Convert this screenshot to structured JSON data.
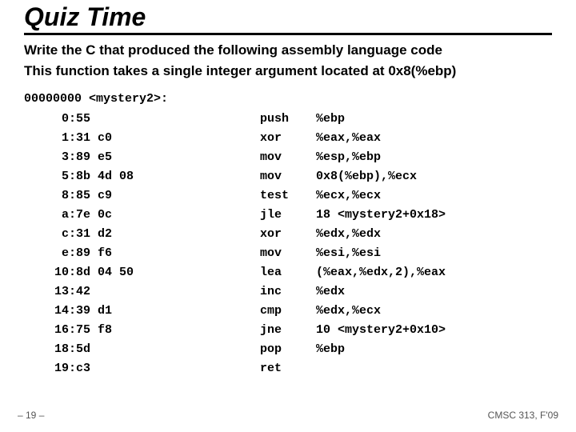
{
  "title": "Quiz Time",
  "subtitle_line1": "Write the C that produced the following assembly language code",
  "subtitle_line2": "This function takes a single integer argument located at 0x8(%ebp)",
  "disasm_header": "00000000 <mystery2>:",
  "rows": [
    {
      "addr": "0:",
      "hex": "55",
      "mnem": "push",
      "oper": "%ebp"
    },
    {
      "addr": "1:",
      "hex": "31 c0",
      "mnem": "xor",
      "oper": "%eax,%eax"
    },
    {
      "addr": "3:",
      "hex": "89 e5",
      "mnem": "mov",
      "oper": "%esp,%ebp"
    },
    {
      "addr": "5:",
      "hex": "8b 4d 08",
      "mnem": "mov",
      "oper": "0x8(%ebp),%ecx"
    },
    {
      "addr": "8:",
      "hex": "85 c9",
      "mnem": "test",
      "oper": "%ecx,%ecx"
    },
    {
      "addr": "a:",
      "hex": "7e 0c",
      "mnem": "jle",
      "oper": "18 <mystery2+0x18>"
    },
    {
      "addr": "c:",
      "hex": "31 d2",
      "mnem": "xor",
      "oper": "%edx,%edx"
    },
    {
      "addr": "e:",
      "hex": "89 f6",
      "mnem": "mov",
      "oper": "%esi,%esi"
    },
    {
      "addr": "10:",
      "hex": "8d 04 50",
      "mnem": "lea",
      "oper": "(%eax,%edx,2),%eax"
    },
    {
      "addr": "13:",
      "hex": "42",
      "mnem": "inc",
      "oper": "%edx"
    },
    {
      "addr": "14:",
      "hex": "39 d1",
      "mnem": "cmp",
      "oper": "%edx,%ecx"
    },
    {
      "addr": "16:",
      "hex": "75 f8",
      "mnem": "jne",
      "oper": "10 <mystery2+0x10>"
    },
    {
      "addr": "18:",
      "hex": "5d",
      "mnem": "pop",
      "oper": "%ebp"
    },
    {
      "addr": "19:",
      "hex": "c3",
      "mnem": "ret",
      "oper": ""
    }
  ],
  "footer_left": "– 19 –",
  "footer_right": "CMSC 313, F'09"
}
